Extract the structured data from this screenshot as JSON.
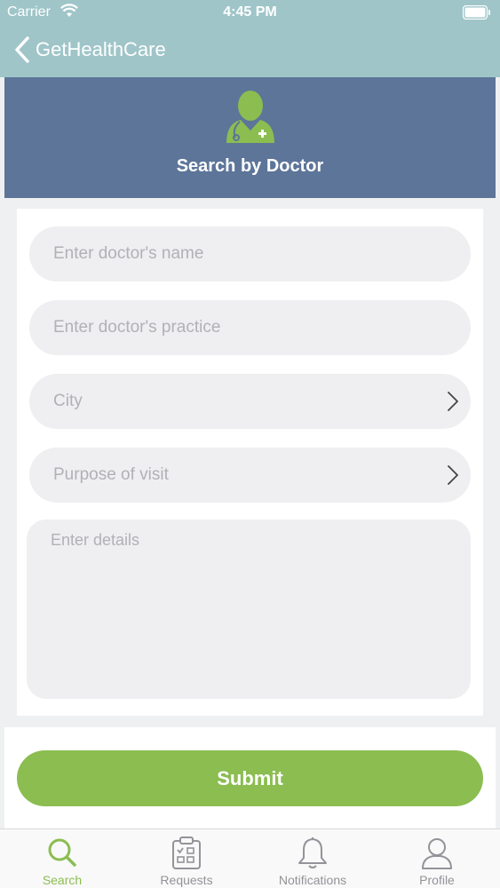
{
  "status_bar": {
    "carrier": "Carrier",
    "time": "4:45 PM"
  },
  "nav": {
    "back_title": "GetHealthCare"
  },
  "banner": {
    "icon": "doctor-icon",
    "title": "Search by Doctor"
  },
  "form": {
    "name_placeholder": "Enter doctor's name",
    "practice_placeholder": "Enter doctor's practice",
    "city_placeholder": "City",
    "purpose_placeholder": "Purpose of visit",
    "details_placeholder": "Enter details"
  },
  "submit_label": "Submit",
  "tabs": [
    {
      "label": "Search",
      "icon": "search-icon",
      "active": true
    },
    {
      "label": "Requests",
      "icon": "clipboard-icon",
      "active": false
    },
    {
      "label": "Notifications",
      "icon": "bell-icon",
      "active": false
    },
    {
      "label": "Profile",
      "icon": "person-icon",
      "active": false
    }
  ],
  "colors": {
    "nav_bg": "#9fc5c9",
    "banner_bg": "#5d7599",
    "accent_green": "#8bbd51",
    "field_bg": "#efeff1",
    "inactive_tab": "#939399"
  }
}
